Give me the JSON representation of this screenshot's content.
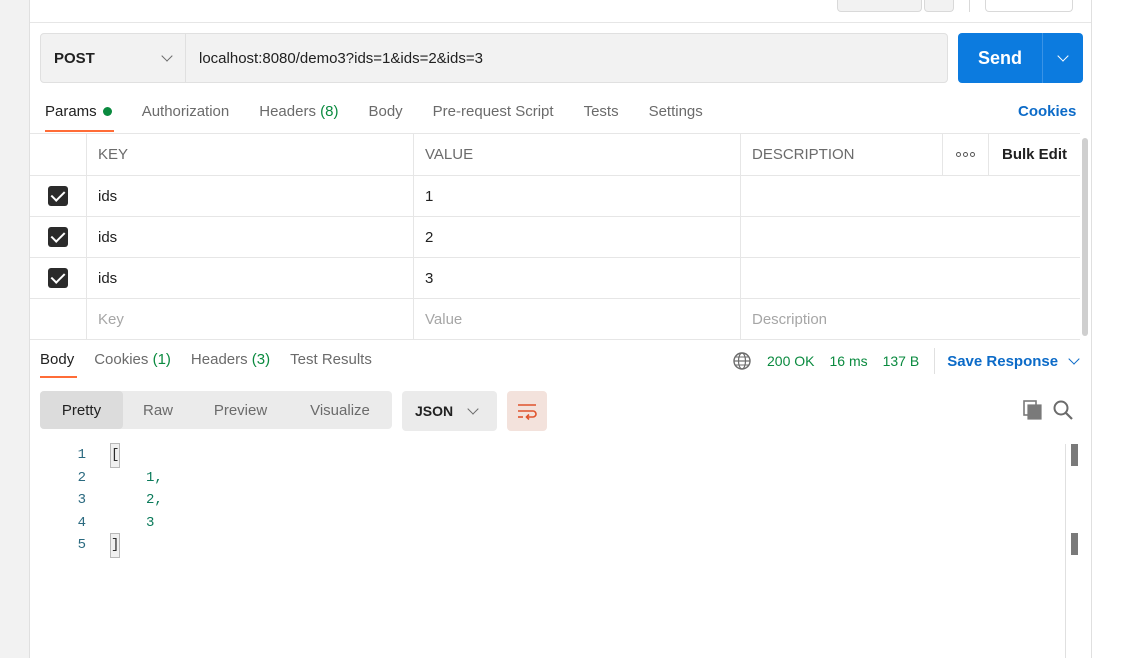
{
  "request": {
    "method": "POST",
    "url": "localhost:8080/demo3?ids=1&ids=2&ids=3",
    "send_label": "Send"
  },
  "request_tabs": {
    "params": "Params",
    "authorization": "Authorization",
    "headers": "Headers",
    "headers_count": "(8)",
    "body": "Body",
    "prerequest": "Pre-request Script",
    "tests": "Tests",
    "settings": "Settings",
    "cookies": "Cookies"
  },
  "params_table": {
    "headers": {
      "key": "KEY",
      "value": "VALUE",
      "description": "DESCRIPTION",
      "bulk_edit": "Bulk Edit"
    },
    "rows": [
      {
        "key": "ids",
        "value": "1",
        "description": "",
        "checked": true
      },
      {
        "key": "ids",
        "value": "2",
        "description": "",
        "checked": true
      },
      {
        "key": "ids",
        "value": "3",
        "description": "",
        "checked": true
      }
    ],
    "placeholders": {
      "key": "Key",
      "value": "Value",
      "description": "Description"
    }
  },
  "response_tabs": {
    "body": "Body",
    "cookies": "Cookies",
    "cookies_count": "(1)",
    "headers": "Headers",
    "headers_count": "(3)",
    "test_results": "Test Results"
  },
  "response_status": {
    "status": "200 OK",
    "time": "16 ms",
    "size": "137 B",
    "save_response": "Save Response"
  },
  "view_modes": [
    "Pretty",
    "Raw",
    "Preview",
    "Visualize"
  ],
  "format": "JSON",
  "response_body": {
    "lines": [
      {
        "num": "1",
        "text": "["
      },
      {
        "num": "2",
        "text": "1,"
      },
      {
        "num": "3",
        "text": "2,"
      },
      {
        "num": "4",
        "text": "3"
      },
      {
        "num": "5",
        "text": "]"
      }
    ]
  },
  "colors": {
    "accent_orange": "#ff6c37",
    "send_blue": "#0c7bdf",
    "link_blue": "#0c6bc8",
    "success_green": "#0a8a3f"
  },
  "icons": [
    "chevron-down-icon",
    "checkbox-checked-icon",
    "more-dots-icon",
    "globe-icon",
    "wrap-lines-icon",
    "copy-icon",
    "search-icon"
  ]
}
